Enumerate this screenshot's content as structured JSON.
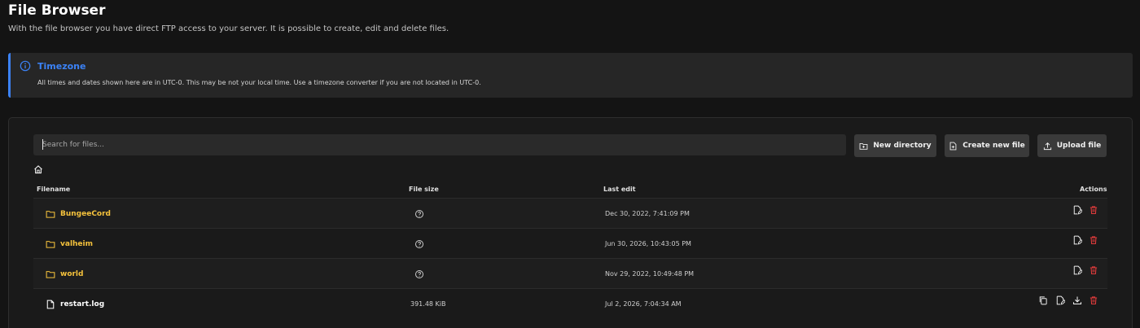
{
  "header": {
    "title": "File Browser",
    "subtitle": "With the file browser you have direct FTP access to your server. It is possible to create, edit and delete files."
  },
  "alert": {
    "title": "Timezone",
    "text": "All times and dates shown here are in UTC-0. This may be not your local time. Use a timezone converter if you are not located in UTC-0.",
    "accent": "#3b82f6",
    "icon": "info-icon"
  },
  "search": {
    "placeholder": "Search for files...",
    "value": ""
  },
  "toolbar": {
    "new_directory_label": "New directory",
    "create_file_label": "Create new file",
    "upload_label": "Upload file"
  },
  "table": {
    "headers": {
      "filename": "Filename",
      "size": "File size",
      "edited": "Last edit",
      "actions": "Actions"
    },
    "rows": [
      {
        "name": "BungeeCord",
        "type": "folder",
        "size_icon": "question-circle-icon",
        "edited": "Dec 30, 2022, 7:41:09 PM"
      },
      {
        "name": "valheim",
        "type": "folder",
        "size_icon": "question-circle-icon",
        "edited": "Jun 30, 2026, 10:43:05 PM"
      },
      {
        "name": "world",
        "type": "folder",
        "size_icon": "question-circle-icon",
        "edited": "Nov 29, 2022, 10:49:48 PM"
      },
      {
        "name": "restart.log",
        "type": "file",
        "size": "391.48 KiB",
        "edited": "Jul 2, 2026, 7:04:34 AM"
      }
    ]
  },
  "colors": {
    "folder": "#f5c23c",
    "delete": "#e23b3b",
    "accent": "#3b82f6"
  }
}
